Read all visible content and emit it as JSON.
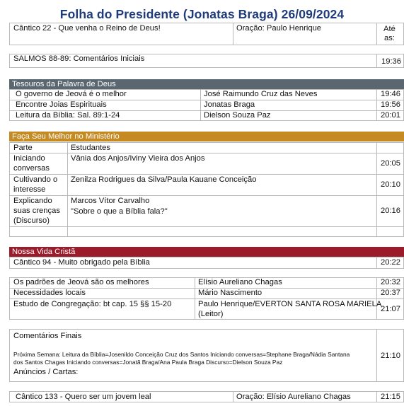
{
  "header": {
    "title": "Folha do Presidente (Jonatas Braga) 26/09/2024"
  },
  "opening": {
    "song": "Cântico 22 - Que venha o Reino de Deus!",
    "prayer": "Oração: Paulo Henrique",
    "time_a": "Até",
    "time_b": "as:"
  },
  "psalms": {
    "label": "SALMOS 88-89:  Comentários Iniciais",
    "time": "19:36"
  },
  "tesouros": {
    "title": "Tesouros da Palavra de Deus",
    "color": "#5b6770",
    "rows": [
      {
        "part": "O governo de Jeová é o melhor",
        "name": "José Raimundo Cruz das Neves",
        "time": "19:46"
      },
      {
        "part": "Encontre Joias Espirituais",
        "name": "Jonatas Braga",
        "time": "19:56"
      },
      {
        "part": "Leitura da Bíblia: Sal. 89:1-24",
        "name": "Dielson Souza Paz",
        "time": "20:01"
      }
    ]
  },
  "ministerio": {
    "title": "Faça Seu Melhor no Ministério",
    "color": "#c58a21",
    "col_part": "Parte",
    "col_students": "Estudantes",
    "rows": [
      {
        "part_1": "Iniciando",
        "part_2": "conversas",
        "students": "Vânia dos Anjos/Iviny Vieira dos Anjos",
        "time": "20:05"
      },
      {
        "part_1": "Cultivando o",
        "part_2": "interesse",
        "students": "Zenilza Rodrigues da Silva/Paula Kauane Conceição",
        "time": "20:10"
      },
      {
        "part_1": "Explicando",
        "part_2": "suas crenças",
        "part_3": "(Discurso)",
        "students": "Marcos Vítor Carvalho",
        "students_2": "\"Sobre o que a Bíblia fala?\"",
        "time": "20:16"
      }
    ]
  },
  "vida_crista": {
    "title": "Nossa Vida Cristã",
    "color": "#9b1b2a",
    "song": "Cântico 94 - Muito obrigado pela Bíblia",
    "song_time": "20:22",
    "rows": [
      {
        "part": "Os padrões de Jeová são os melhores",
        "name": "Elísio Aureliano Chagas",
        "time": "20:32"
      },
      {
        "part": "Necessidades locais",
        "name": "Mário Nascimento",
        "time": "20:37"
      },
      {
        "part": "Estudo de Congregação: bt cap. 15 §§ 15-20",
        "name": "Paulo Henrique/EVERTON SANTA ROSA MARIELA",
        "name_2": "(Leitor)",
        "time": "21:07"
      }
    ]
  },
  "closing": {
    "comments": "Comentários Finais",
    "next_week_1": "Próxima Semana: Leitura da Bíblia=Josenildo Conceição Cruz dos Santos Iniciando conversas=Stephane Braga/Nádia Santana",
    "next_week_2": "dos Santos Chagas Iniciando conversas=Jonatã Braga/Ana Paula Braga Discurso=Dielson Souza Paz",
    "announcements": "Anúncios / Cartas:",
    "time": "21:10",
    "final_song": "Cântico 133 - Quero ser um jovem leal",
    "final_prayer": "Oração:  Elísio Aureliano Chagas",
    "final_time": "21:15"
  }
}
